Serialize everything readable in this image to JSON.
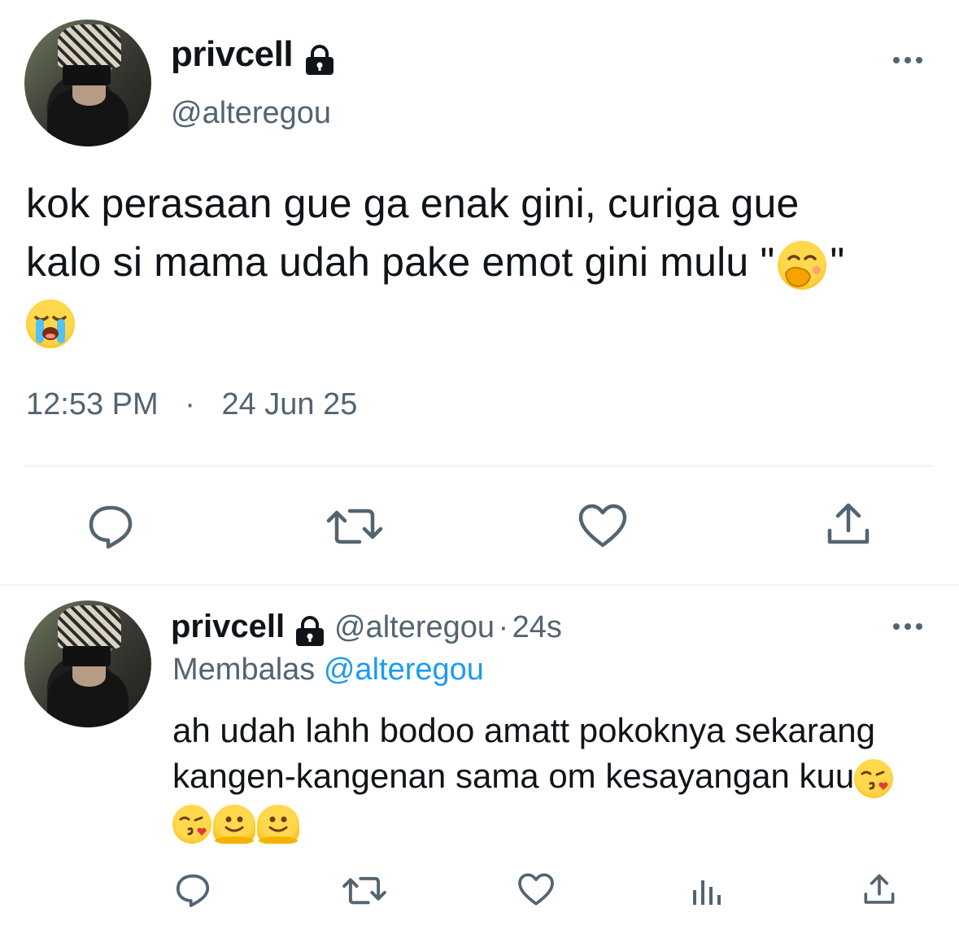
{
  "main_tweet": {
    "display_name": "privcell",
    "handle": "@alteregou",
    "text_line1": "kok perasaan gue ga enak gini, curiga gue",
    "text_line2": "kalo si mama udah pake emot gini mulu \"",
    "text_line2_end": "\"",
    "time": "12:53 PM",
    "separator": "·",
    "date": "24 Jun 25",
    "emoji_icons": [
      "face-with-hand-over-mouth-icon",
      "loudly-crying-face-icon"
    ]
  },
  "reply_tweet": {
    "display_name": "privcell",
    "handle": "@alteregou",
    "dot": "·",
    "age": "24s",
    "replying_label": "Membalas",
    "replying_to": "@alteregou",
    "text_line1": "ah udah lahh bodoo amatt pokoknya sekarang",
    "text_line2": "kangen-kangenan sama om kesayangan kuu",
    "emoji_icons": [
      "face-blowing-kiss-icon",
      "face-blowing-kiss-icon",
      "melting-face-icon",
      "melting-face-icon"
    ]
  },
  "colors": {
    "text": "#0f1419",
    "secondary": "#536471",
    "link": "#1d9bf0",
    "divider": "#eff3f4"
  }
}
